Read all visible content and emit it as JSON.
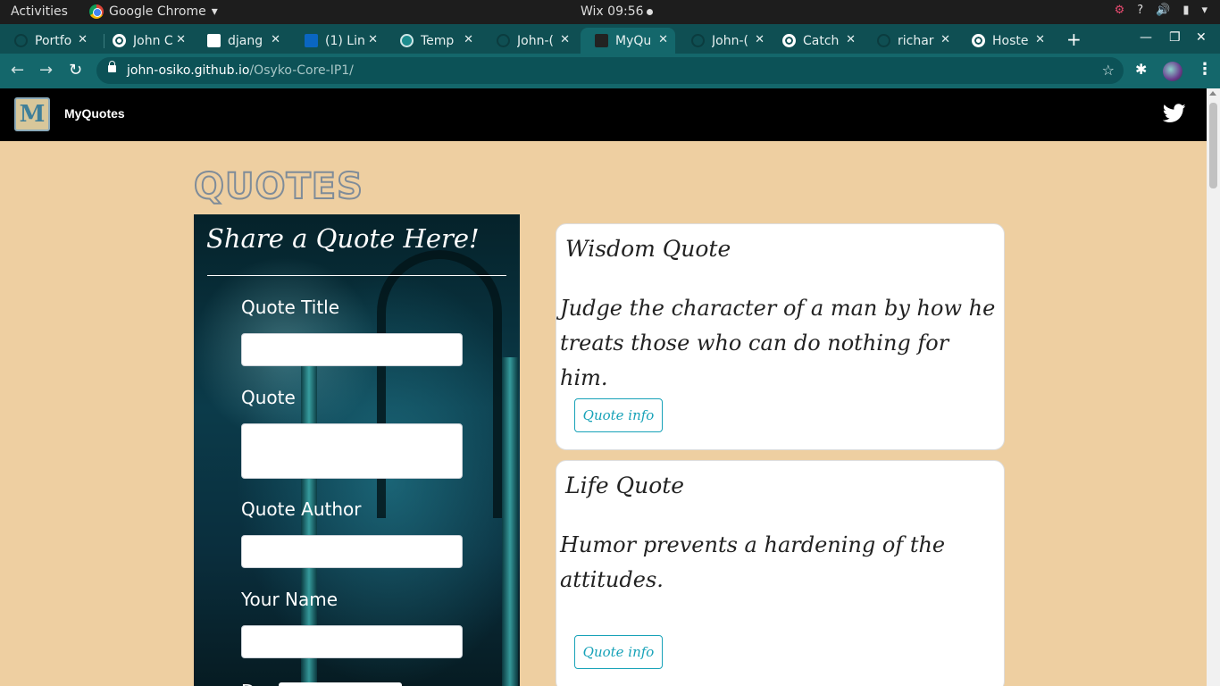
{
  "os": {
    "activities": "Activities",
    "app_name": "Google Chrome",
    "clock": "Wix 09:56",
    "tray": {
      "help": "?"
    }
  },
  "tabs": [
    {
      "title": "Portfo",
      "favicon": "github-icon"
    },
    {
      "title": "John C",
      "favicon": "globe-icon"
    },
    {
      "title": "djang",
      "favicon": "django-icon"
    },
    {
      "title": "(1) Lin",
      "favicon": "linkedin-icon"
    },
    {
      "title": "Temp",
      "favicon": "template-icon"
    },
    {
      "title": "John-(",
      "favicon": "github-icon"
    },
    {
      "title": "MyQu",
      "favicon": "angular-icon",
      "active": true
    },
    {
      "title": "John-(",
      "favicon": "github-icon"
    },
    {
      "title": "Catch",
      "favicon": "globe-icon"
    },
    {
      "title": "richar",
      "favicon": "github-icon"
    },
    {
      "title": "Hoste",
      "favicon": "globe-icon"
    }
  ],
  "browser": {
    "url_host": "john-osiko.github.io",
    "url_path": "/Osyko-Core-IP1/"
  },
  "site": {
    "brand": "MyQuotes",
    "logo_letter": "M",
    "heading": "QUOTES"
  },
  "form": {
    "title": "Share a Quote Here!",
    "fields": {
      "title_label": "Quote Title",
      "quote_label": "Quote",
      "author_label": "Quote Author",
      "name_label": "Your Name",
      "title_value": "",
      "quote_value": "",
      "author_value": "",
      "name_value": ""
    },
    "partial_label": "D"
  },
  "quotes": [
    {
      "title": "Wisdom Quote",
      "body": "Judge the character of a man by how he treats those who can do nothing for him.",
      "button": "Quote info"
    },
    {
      "title": "Life Quote",
      "body": "Humor prevents a hardening of the attitudes.",
      "button": "Quote info"
    }
  ],
  "colors": {
    "page_bg": "#eecfa1",
    "navbar_bg": "#000000",
    "accent": "#17a2b8",
    "tab_strip": "#0f4f53",
    "toolbar": "#14676b"
  }
}
